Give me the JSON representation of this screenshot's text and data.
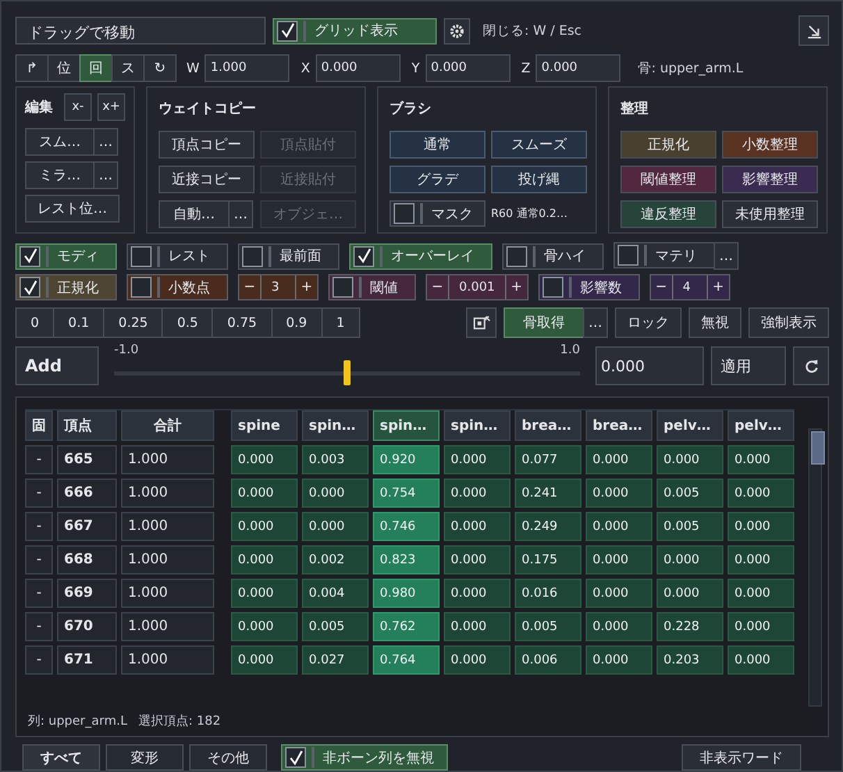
{
  "header": {
    "drag_handle": "ドラッグで移動",
    "grid_toggle": {
      "label": "グリッド表示",
      "checked": true
    },
    "close_hint": "閉じる: W / Esc"
  },
  "transform": {
    "modes": [
      {
        "label": "↱",
        "selected": false
      },
      {
        "label": "位",
        "selected": false
      },
      {
        "label": "回",
        "selected": true
      },
      {
        "label": "ス",
        "selected": false
      },
      {
        "label": "↻",
        "selected": false
      }
    ],
    "fields": [
      {
        "label": "W",
        "value": "1.000"
      },
      {
        "label": "X",
        "value": "0.000"
      },
      {
        "label": "Y",
        "value": "0.000"
      },
      {
        "label": "Z",
        "value": "0.000"
      }
    ],
    "bone": "骨: upper_arm.L"
  },
  "edit": {
    "title": "編集",
    "axis_buttons": [
      "x-",
      "x+"
    ],
    "actions": [
      {
        "label": "スム…",
        "more": "…"
      },
      {
        "label": "ミラ…",
        "more": "…"
      },
      {
        "label": "レスト位…"
      }
    ]
  },
  "weight_copy": {
    "title": "ウェイトコピー",
    "buttons": [
      {
        "label": "頂点コピー",
        "disabled": false
      },
      {
        "label": "頂点貼付",
        "disabled": true
      },
      {
        "label": "近接コピー",
        "disabled": false
      },
      {
        "label": "近接貼付",
        "disabled": true
      },
      {
        "label": "自動…",
        "more": "…",
        "disabled": false
      },
      {
        "label": "オブジェ…",
        "disabled": true
      }
    ]
  },
  "brush": {
    "title": "ブラシ",
    "modes": [
      "通常",
      "スムーズ",
      "グラデ",
      "投げ縄"
    ],
    "mask": {
      "label": "マスク",
      "checked": false
    },
    "status": "R60 通常0.2…"
  },
  "cleanup": {
    "title": "整理",
    "buttons": [
      {
        "label": "正規化",
        "color": "#4a4030"
      },
      {
        "label": "小数整理",
        "color": "#5a3222"
      },
      {
        "label": "閾値整理",
        "color": "#52283e"
      },
      {
        "label": "影響整理",
        "color": "#3a2c50"
      },
      {
        "label": "違反整理",
        "color": "#27443a"
      },
      {
        "label": "未使用整理",
        "color": "#2a2f38"
      }
    ]
  },
  "view_toggles": [
    {
      "label": "モディ",
      "checked": true
    },
    {
      "label": "レスト",
      "checked": false
    },
    {
      "label": "最前面",
      "checked": false
    },
    {
      "label": "オーバーレイ",
      "checked": true
    },
    {
      "label": "骨ハイ",
      "checked": false
    },
    {
      "label": "マテリ",
      "checked": false,
      "more": "…"
    }
  ],
  "options": [
    {
      "kind": "toggle",
      "label": "正規化",
      "checked": true,
      "color": "#4e4632"
    },
    {
      "kind": "toggle",
      "label": "小数点",
      "checked": false,
      "color": "#4a2c1e"
    },
    {
      "kind": "stepper",
      "minus": "−",
      "value": "3",
      "plus": "+",
      "color": "#4a2c1e"
    },
    {
      "kind": "toggle",
      "label": "閾値",
      "checked": false,
      "color": "#46283e"
    },
    {
      "kind": "stepper",
      "minus": "−",
      "value": "0.001",
      "plus": "+",
      "color": "#46283e"
    },
    {
      "kind": "toggle",
      "label": "影響数",
      "checked": false,
      "color": "#33284a"
    },
    {
      "kind": "stepper",
      "minus": "−",
      "value": "4",
      "plus": "+",
      "color": "#33284a"
    }
  ],
  "presets": [
    "0",
    "0.1",
    "0.25",
    "0.5",
    "0.75",
    "0.9",
    "1"
  ],
  "bone_actions": {
    "fetch": {
      "label": "骨取得",
      "more": "…"
    },
    "buttons": [
      "ロック",
      "無視",
      "強制表示"
    ]
  },
  "slider": {
    "mode": "Add",
    "min_label": "-1.0",
    "max_label": "1.0",
    "level": 0.5,
    "value": "0.000",
    "apply": "適用"
  },
  "table": {
    "columns": [
      "固",
      "頂点",
      "合計"
    ],
    "bone_columns": [
      {
        "label": "spine",
        "selected": false
      },
      {
        "label": "spin…",
        "selected": false
      },
      {
        "label": "spin…",
        "selected": true
      },
      {
        "label": "spin…",
        "selected": false
      },
      {
        "label": "brea…",
        "selected": false
      },
      {
        "label": "brea…",
        "selected": false
      },
      {
        "label": "pelv…",
        "selected": false
      },
      {
        "label": "pelv…",
        "selected": false
      }
    ],
    "rows": [
      {
        "lock": "-",
        "vertex": "665",
        "total": "1.000",
        "weights": [
          "0.000",
          "0.003",
          "0.920",
          "0.000",
          "0.077",
          "0.000",
          "0.000",
          "0.000"
        ]
      },
      {
        "lock": "-",
        "vertex": "666",
        "total": "1.000",
        "weights": [
          "0.000",
          "0.000",
          "0.754",
          "0.000",
          "0.241",
          "0.000",
          "0.005",
          "0.000"
        ]
      },
      {
        "lock": "-",
        "vertex": "667",
        "total": "1.000",
        "weights": [
          "0.000",
          "0.000",
          "0.746",
          "0.000",
          "0.249",
          "0.000",
          "0.005",
          "0.000"
        ]
      },
      {
        "lock": "-",
        "vertex": "668",
        "total": "1.000",
        "weights": [
          "0.000",
          "0.002",
          "0.823",
          "0.000",
          "0.175",
          "0.000",
          "0.000",
          "0.000"
        ]
      },
      {
        "lock": "-",
        "vertex": "669",
        "total": "1.000",
        "weights": [
          "0.000",
          "0.004",
          "0.980",
          "0.000",
          "0.016",
          "0.000",
          "0.000",
          "0.000"
        ]
      },
      {
        "lock": "-",
        "vertex": "670",
        "total": "1.000",
        "weights": [
          "0.000",
          "0.005",
          "0.762",
          "0.000",
          "0.005",
          "0.000",
          "0.228",
          "0.000"
        ]
      },
      {
        "lock": "-",
        "vertex": "671",
        "total": "1.000",
        "weights": [
          "0.000",
          "0.027",
          "0.764",
          "0.000",
          "0.006",
          "0.000",
          "0.203",
          "0.000"
        ]
      }
    ],
    "status_column": "列: upper_arm.L",
    "status_selected": "選択頂点: 182"
  },
  "footer": {
    "tabs": [
      {
        "label": "すべて",
        "selected": true
      },
      {
        "label": "変形",
        "selected": false
      },
      {
        "label": "その他",
        "selected": false
      }
    ],
    "ignore_toggle": {
      "label": "非ボーン列を無視",
      "checked": true
    },
    "hidden_words": "非表示ワード"
  }
}
